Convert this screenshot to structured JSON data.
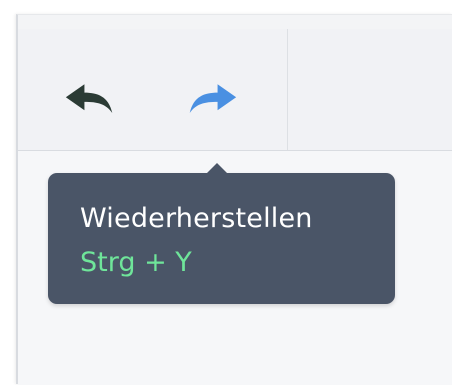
{
  "toolbar": {
    "undo_icon": "undo-arrow-icon",
    "redo_icon": "redo-arrow-icon",
    "undo_color": "#2b3b35",
    "redo_color": "#4a90e2"
  },
  "tooltip": {
    "title": "Wiederherstellen",
    "shortcut": "Strg + Y",
    "background": "#4a5567",
    "shortcut_color": "#6fe59a"
  }
}
